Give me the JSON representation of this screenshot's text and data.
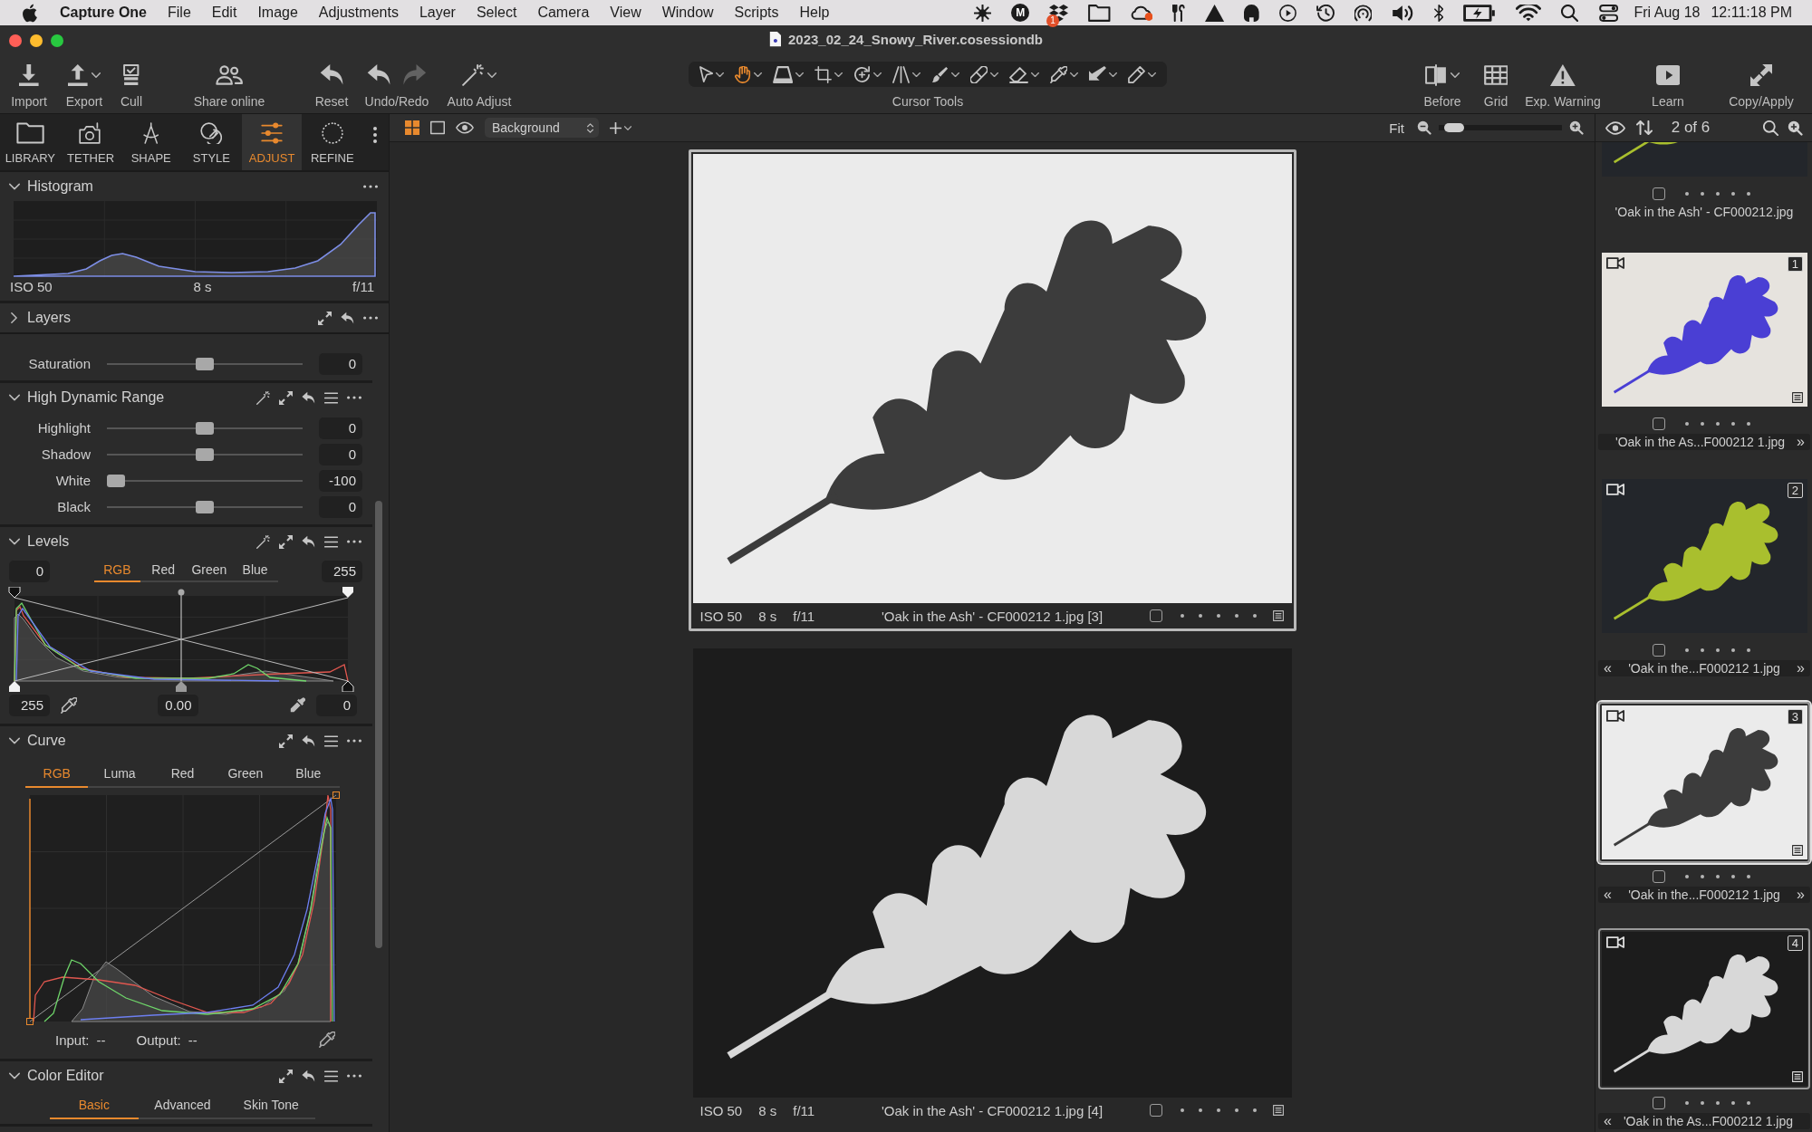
{
  "menu_bar": {
    "app_name": "Capture One",
    "menus": [
      "File",
      "Edit",
      "Image",
      "Adjustments",
      "Layer",
      "Select",
      "Camera",
      "View",
      "Window",
      "Scripts",
      "Help"
    ],
    "status_letter": "M",
    "dropbox_badge": "1",
    "date": "Fri Aug 18",
    "time": "12:11:18 PM"
  },
  "window": {
    "title": "2023_02_24_Snowy_River.cosessiondb"
  },
  "toolbar": {
    "import": {
      "label": "Import"
    },
    "export": {
      "label": "Export",
      "menu": true
    },
    "cull": {
      "label": "Cull"
    },
    "share_online": {
      "label": "Share online"
    },
    "reset": {
      "label": "Reset"
    },
    "undo_redo": {
      "label": "Undo/Redo",
      "redo_disabled": true
    },
    "auto_adjust": {
      "label": "Auto Adjust",
      "menu": true
    },
    "cursor_tools": {
      "label": "Cursor Tools",
      "tools": [
        {
          "selected": false
        },
        {
          "selected": true
        },
        {
          "selected": false
        },
        {
          "selected": false
        },
        {
          "selected": false
        },
        {
          "selected": false
        },
        {
          "selected": false
        },
        {
          "selected": false
        },
        {
          "selected": false
        },
        {
          "selected": false
        },
        {
          "selected": false
        },
        {
          "selected": false
        }
      ]
    },
    "before": {
      "label": "Before",
      "menu": true
    },
    "grid": {
      "label": "Grid"
    },
    "exp_warning": {
      "label": "Exp. Warning"
    },
    "learn": {
      "label": "Learn"
    },
    "copy_apply": {
      "label": "Copy/Apply"
    }
  },
  "tool_tabs": [
    {
      "label": "LIBRARY",
      "selected": false
    },
    {
      "label": "TETHER",
      "selected": false
    },
    {
      "label": "SHAPE",
      "selected": false
    },
    {
      "label": "STYLE",
      "selected": false
    },
    {
      "label": "ADJUST",
      "selected": true
    },
    {
      "label": "REFINE",
      "selected": false
    }
  ],
  "histogram": {
    "title": "Histogram",
    "expanded": true,
    "iso": "ISO 50",
    "shutter": "8 s",
    "aperture": "f/11"
  },
  "layers": {
    "title": "Layers",
    "expanded": false
  },
  "partial_tool": {
    "sliders": [
      {
        "label": "Saturation",
        "value": "0",
        "level": 0.5
      }
    ]
  },
  "hdr": {
    "title": "High Dynamic Range",
    "expanded": true,
    "sliders": [
      {
        "label": "Highlight",
        "value": "0",
        "level": 0.5
      },
      {
        "label": "Shadow",
        "value": "0",
        "level": 0.5
      },
      {
        "label": "White",
        "value": "-100",
        "level": 0
      },
      {
        "label": "Black",
        "value": "0",
        "level": 0.5
      }
    ]
  },
  "levels": {
    "title": "Levels",
    "expanded": true,
    "input_low": "0",
    "channels": [
      {
        "label": "RGB",
        "selected": true
      },
      {
        "label": "Red",
        "selected": false
      },
      {
        "label": "Green",
        "selected": false
      },
      {
        "label": "Blue",
        "selected": false
      }
    ],
    "input_high": "255",
    "output_low": "255",
    "midtone": "0.00",
    "output_high": "0"
  },
  "curve": {
    "title": "Curve",
    "expanded": true,
    "channels": [
      {
        "label": "RGB",
        "selected": true
      },
      {
        "label": "Luma",
        "selected": false
      },
      {
        "label": "Red",
        "selected": false
      },
      {
        "label": "Green",
        "selected": false
      },
      {
        "label": "Blue",
        "selected": false
      }
    ],
    "input_label": "Input:",
    "input_value": "--",
    "output_label": "Output:",
    "output_value": "--"
  },
  "color_editor": {
    "title": "Color Editor",
    "expanded": true,
    "tabs": [
      {
        "label": "Basic",
        "selected": true
      },
      {
        "label": "Advanced",
        "selected": false
      },
      {
        "label": "Skin Tone",
        "selected": false
      }
    ]
  },
  "viewer_toolbar": {
    "views": [
      {
        "selected": true
      },
      {
        "selected": false
      },
      {
        "selected": false
      }
    ],
    "layer": "Background",
    "zoom_label": "Fit",
    "zoom_slider": {
      "level": 0.05
    }
  },
  "viewer": {
    "images": [
      {
        "kind": "negative",
        "primary": true,
        "iso": "ISO 50",
        "shutter": "8 s",
        "aperture": "f/11",
        "filename": "'Oak in the Ash' - CF000212 1.jpg [3]",
        "checked": false,
        "adjusted": true
      },
      {
        "kind": "positive",
        "primary": false,
        "iso": "ISO 50",
        "shutter": "8 s",
        "aperture": "f/11",
        "filename": "'Oak in the Ash' - CF000212 1.jpg [4]",
        "checked": false,
        "adjusted": true
      }
    ]
  },
  "filmstrip": {
    "position": "2 of 6",
    "items": [
      {
        "kind": "gold",
        "name": "'Oak in the Ash' - CF000212.jpg",
        "selected": false,
        "primary": false,
        "checked": false,
        "adjusted": false
      },
      {
        "kind": "blue",
        "badge": "1",
        "name": "'Oak in the As...F000212 1.jpg",
        "next": "»",
        "selected": false,
        "primary": false,
        "checked": false,
        "adjusted": true
      },
      {
        "kind": "gold",
        "badge": "2",
        "prev": "«",
        "name": "'Oak in the...F000212 1.jpg",
        "next": "»",
        "selected": false,
        "primary": false,
        "checked": false,
        "adjusted": false
      },
      {
        "kind": "negative",
        "badge": "3",
        "prev": "«",
        "name": "'Oak in the...F000212 1.jpg",
        "next": "»",
        "selected": true,
        "primary": true,
        "checked": false,
        "adjusted": true
      },
      {
        "kind": "positive",
        "badge": "4",
        "prev": "«",
        "name": "'Oak in the As...F000212 1.jpg",
        "selected": true,
        "primary": false,
        "checked": false,
        "adjusted": true
      }
    ]
  }
}
